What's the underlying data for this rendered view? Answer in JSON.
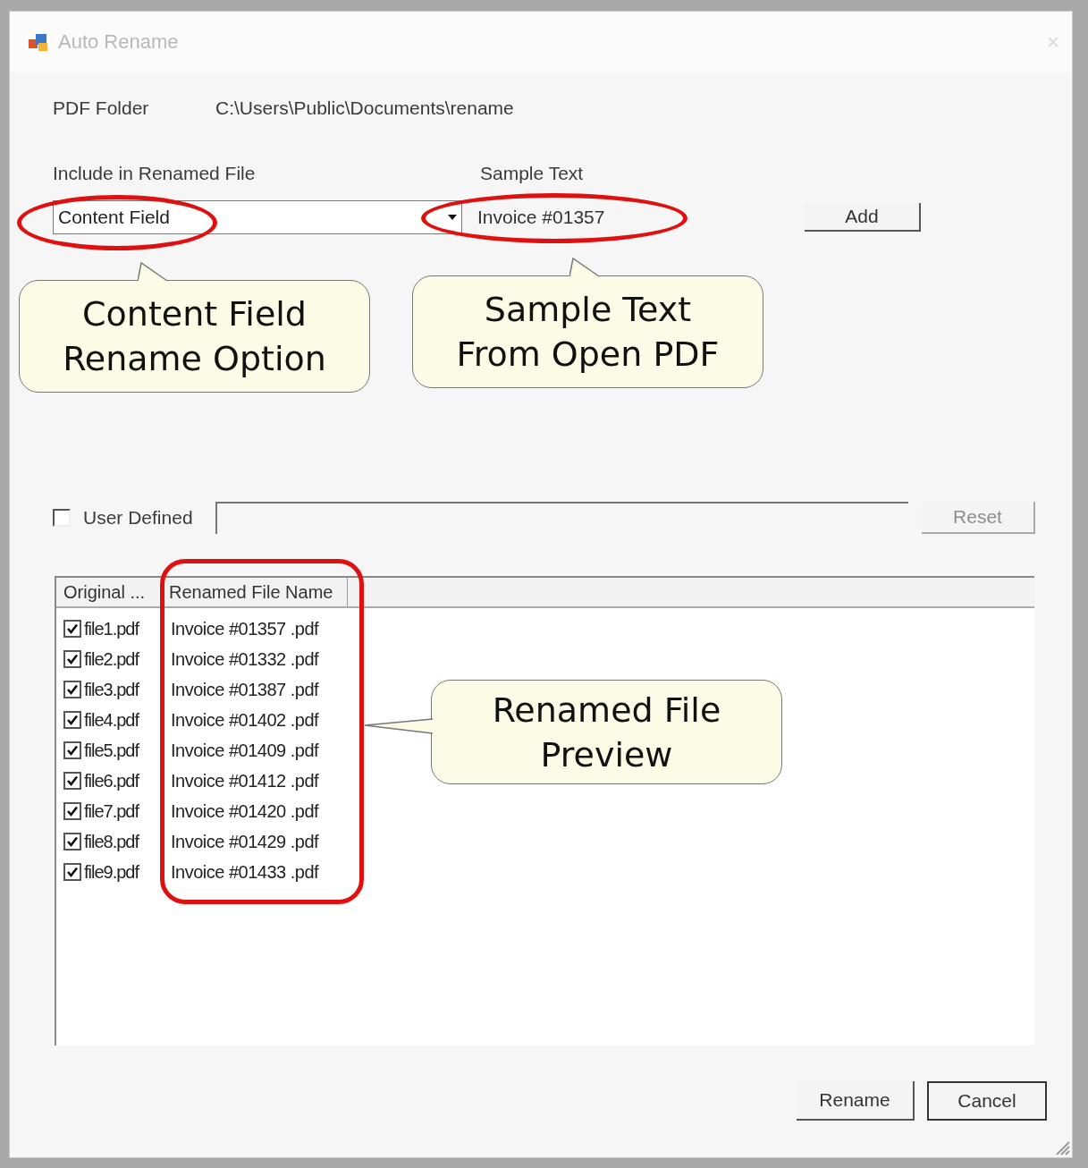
{
  "window": {
    "title": "Auto Rename"
  },
  "pdf_folder": {
    "label": "PDF Folder",
    "value": "C:\\Users\\Public\\Documents\\rename"
  },
  "include": {
    "label": "Include in Renamed File",
    "value": "Content Field"
  },
  "sample": {
    "label": "Sample Text",
    "value": "Invoice #01357"
  },
  "add_button": {
    "label": "Add"
  },
  "user_defined": {
    "label": "User Defined",
    "checked": false
  },
  "reset_button": {
    "label": "Reset",
    "disabled": true
  },
  "table": {
    "columns": [
      "Original ...",
      "Renamed File Name"
    ],
    "rows": [
      {
        "original": "file1.pdf",
        "renamed": "Invoice #01357 .pdf",
        "checked": true
      },
      {
        "original": "file2.pdf",
        "renamed": "Invoice #01332 .pdf",
        "checked": true
      },
      {
        "original": "file3.pdf",
        "renamed": "Invoice #01387 .pdf",
        "checked": true
      },
      {
        "original": "file4.pdf",
        "renamed": "Invoice #01402 .pdf",
        "checked": true
      },
      {
        "original": "file5.pdf",
        "renamed": "Invoice #01409 .pdf",
        "checked": true
      },
      {
        "original": "file6.pdf",
        "renamed": "Invoice #01412 .pdf",
        "checked": true
      },
      {
        "original": "file7.pdf",
        "renamed": "Invoice #01420 .pdf",
        "checked": true
      },
      {
        "original": "file8.pdf",
        "renamed": "Invoice #01429 .pdf",
        "checked": true
      },
      {
        "original": "file9.pdf",
        "renamed": "Invoice #01433 .pdf",
        "checked": true
      }
    ]
  },
  "buttons": [
    {
      "label": "Rename",
      "kind": "flat"
    },
    {
      "label": "Cancel",
      "kind": "default"
    }
  ],
  "callouts": [
    {
      "lines": [
        "Content Field",
        "Rename Option"
      ],
      "kind": "up"
    },
    {
      "lines": [
        "Sample Text",
        "From Open PDF"
      ],
      "kind": "up"
    },
    {
      "lines": [
        "Renamed File",
        "Preview"
      ],
      "kind": "left"
    }
  ]
}
